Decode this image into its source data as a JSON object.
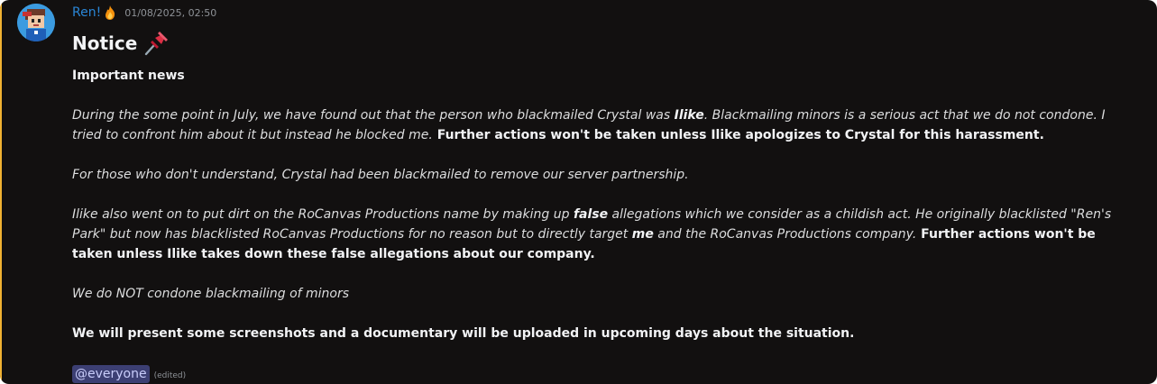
{
  "author": {
    "name": "Ren!",
    "badge_icon": "fire-emoji-icon",
    "timestamp": "01/08/2025, 02:50"
  },
  "message": {
    "heading": "Notice",
    "heading_icon": "pushpin-emoji-icon",
    "subheading": "Important news",
    "p1": {
      "t1": "During the some point in July, we have found out that the person who blackmailed Crystal was ",
      "t2": "Ilike",
      "t3": ". Blackmailing minors is a serious act that we do not condone. I tried to confront him about it but instead he blocked me.",
      "t4": " Further actions won't be taken unless Ilike apologizes to Crystal for this harassment."
    },
    "p2": "For those who don't understand, Crystal had been blackmailed to remove our server partnership.",
    "p3": {
      "t1": "Ilike also went on to put dirt on the RoCanvas Productions name by making up ",
      "t2": "false",
      "t3": " allegations which we consider as a childish act. He originally blacklisted \"Ren's Park\" but now has blacklisted RoCanvas Productions for no reason but to directly target ",
      "t4": "me",
      "t5": " and the RoCanvas Productions company.",
      "t6": " Further actions won't be taken unless Ilike takes down these false allegations about our company."
    },
    "p4": "We do NOT condone blackmailing of minors",
    "p5": "We will present some screenshots and a documentary will be uploaded in upcoming days about the situation.",
    "mention": "@everyone",
    "edited": "(edited)"
  },
  "colors": {
    "background": "#121010",
    "accent_bar": "#f0b232",
    "username": "#2a86d6",
    "mention_bg": "#3c3f73",
    "mention_text": "#c9cdfb"
  }
}
